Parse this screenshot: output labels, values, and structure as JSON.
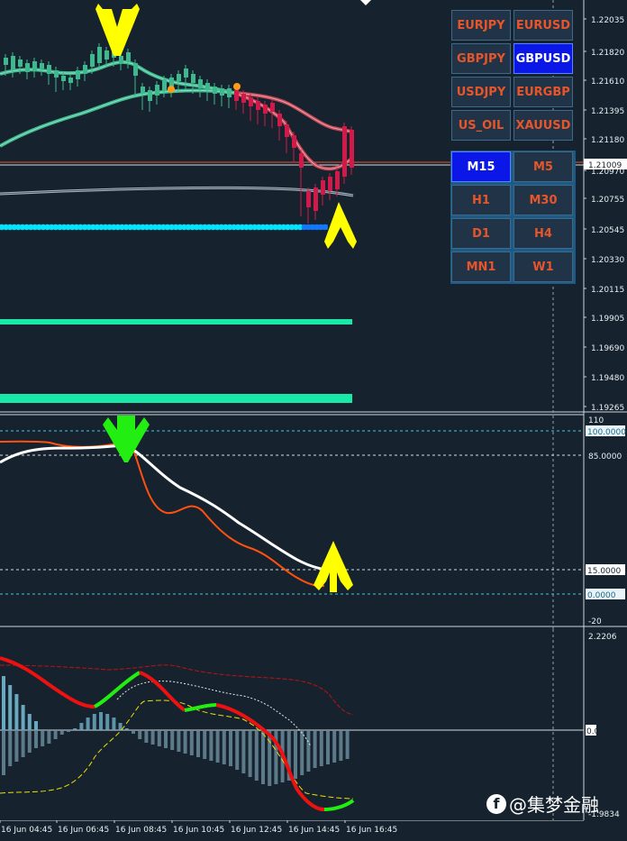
{
  "symbols": [
    "EURJPY",
    "EURUSD",
    "GBPJPY",
    "GBPUSD",
    "USDJPY",
    "EURGBP",
    "US_OIL",
    "XAUUSD"
  ],
  "active_symbol": "GBPUSD",
  "timeframes": [
    "M15",
    "M5",
    "H1",
    "M30",
    "D1",
    "H4",
    "MN1",
    "W1"
  ],
  "active_timeframe": "M15",
  "price_axis": {
    "labels": [
      "1.22035",
      "1.21820",
      "1.21610",
      "1.21395",
      "1.21180",
      "1.20970",
      "1.20755",
      "1.20545",
      "1.20330",
      "1.20115",
      "1.19905",
      "1.19690",
      "1.19480",
      "1.19265"
    ],
    "current_price": "1.21009"
  },
  "stoch_axis": {
    "labels": [
      "110",
      "85.0000",
      "15.0000",
      "-20"
    ],
    "highlight_labels": [
      "100.0000",
      "0.0000"
    ]
  },
  "macd_axis": {
    "labels": [
      "2.2206",
      "0.00",
      "-1.9834"
    ]
  },
  "time_axis": {
    "labels": [
      "16 Jun 04:45",
      "16 Jun 06:45",
      "16 Jun 08:45",
      "16 Jun 10:45",
      "16 Jun 12:45",
      "16 Jun 14:45",
      "16 Jun 16:45"
    ]
  },
  "watermark": {
    "icon": "f",
    "text": "@集梦金融"
  },
  "colors": {
    "background": "#16232e",
    "bull_candle": "#3fb88f",
    "bear_candle": "#d21a4a",
    "signal_arrow_yellow": "#ffff00",
    "signal_arrow_green": "#22ee11",
    "support_line": "#18e8a8",
    "dots": "#00e5ff",
    "button_text": "#e8552a",
    "button_active": "#0a17e6"
  }
}
